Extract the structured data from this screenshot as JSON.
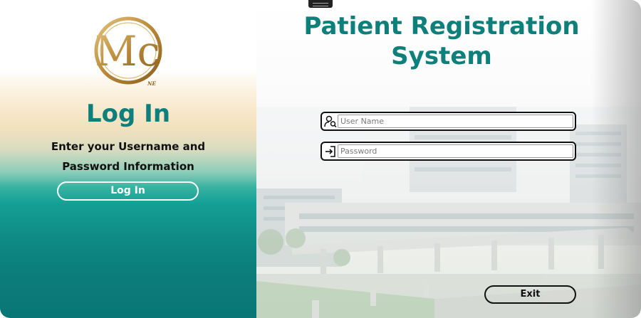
{
  "logo": {
    "letters_main": "Mc",
    "letters_sub": "NE",
    "color": "#b8893a"
  },
  "login_panel": {
    "heading": "Log In",
    "instructions": "Enter your Username and Password Information",
    "button_label": "Log In"
  },
  "title": "Patient Registration System",
  "form": {
    "username": {
      "placeholder": "User Name",
      "value": "",
      "icon": "user-search-icon"
    },
    "password": {
      "placeholder": "Password",
      "value": "",
      "icon": "sign-in-icon"
    }
  },
  "exit_button": "Exit",
  "colors": {
    "teal": "#0e7f7b",
    "gold": "#b8893a",
    "border": "#111111"
  }
}
